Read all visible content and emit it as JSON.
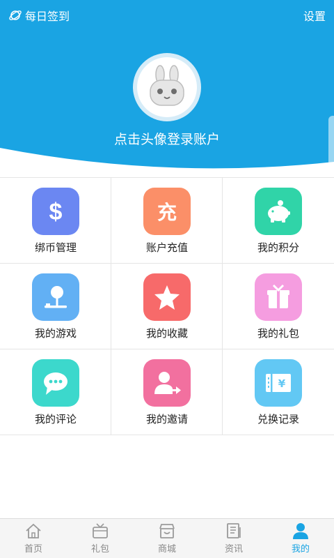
{
  "header": {
    "checkin_label": "每日签到",
    "settings_label": "设置",
    "login_prompt": "点击头像登录账户",
    "bg_color": "#1aa4e3"
  },
  "grid": {
    "items": [
      {
        "label": "绑币管理",
        "icon": "dollar-icon",
        "color": "#6b87f2"
      },
      {
        "label": "账户充值",
        "icon": "recharge-icon",
        "color": "#fb8f68",
        "glyph": "充"
      },
      {
        "label": "我的积分",
        "icon": "piggy-bank-icon",
        "color": "#30d4a8"
      },
      {
        "label": "我的游戏",
        "icon": "joystick-icon",
        "color": "#62b0f4"
      },
      {
        "label": "我的收藏",
        "icon": "star-icon",
        "color": "#f76a6a"
      },
      {
        "label": "我的礼包",
        "icon": "gift-box-icon",
        "color": "#f59de0"
      },
      {
        "label": "我的评论",
        "icon": "comment-icon",
        "color": "#3cd8cc"
      },
      {
        "label": "我的邀请",
        "icon": "invite-user-icon",
        "color": "#f2709f"
      },
      {
        "label": "兑换记录",
        "icon": "ticket-icon",
        "color": "#62c8f4",
        "glyph": "¥"
      }
    ]
  },
  "tabbar": {
    "tabs": [
      {
        "label": "首页",
        "icon": "home-icon"
      },
      {
        "label": "礼包",
        "icon": "gift-tv-icon"
      },
      {
        "label": "商城",
        "icon": "store-icon"
      },
      {
        "label": "资讯",
        "icon": "news-icon"
      },
      {
        "label": "我的",
        "icon": "person-icon",
        "active": true
      }
    ],
    "active_color": "#1aa4e3",
    "inactive_color": "#888888"
  }
}
